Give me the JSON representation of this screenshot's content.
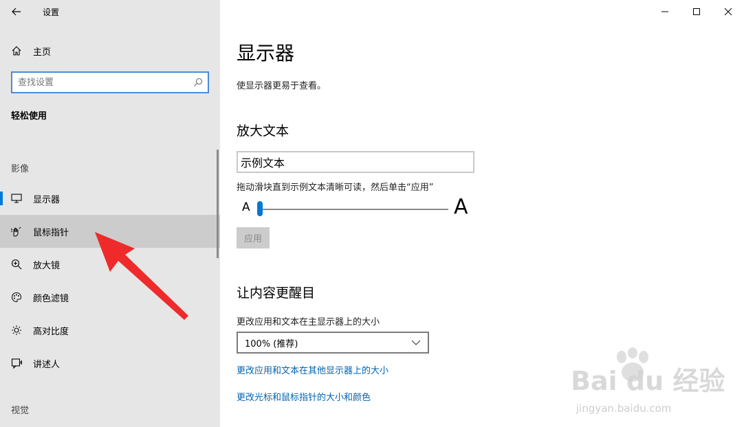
{
  "window": {
    "title": "设置",
    "controls": [
      "minimize-icon",
      "maximize-icon",
      "close-icon"
    ]
  },
  "sidebar": {
    "home_label": "主页",
    "search_placeholder": "查找设置",
    "category": "轻松使用",
    "groups": {
      "vision": "影像",
      "hearing": "视觉"
    },
    "items": [
      {
        "label": "显示器",
        "icon": "monitor-icon",
        "selected": true
      },
      {
        "label": "鼠标指针",
        "icon": "mouse-pointer-icon",
        "hover": true
      },
      {
        "label": "放大镜",
        "icon": "magnifier-icon"
      },
      {
        "label": "颜色滤镜",
        "icon": "palette-icon"
      },
      {
        "label": "高对比度",
        "icon": "sun-icon"
      },
      {
        "label": "讲述人",
        "icon": "narrator-icon"
      }
    ]
  },
  "main": {
    "title": "显示器",
    "description": "使显示器更易于查看。",
    "enlarge_text": {
      "heading": "放大文本",
      "sample_text": "示例文本",
      "hint": "拖动滑块直到示例文本清晰可读，然后单击“应用”",
      "small_a": "A",
      "big_a": "A",
      "slider_value_percent": 0,
      "apply_label": "应用"
    },
    "make_bigger": {
      "heading": "让内容更醒目",
      "size_label": "更改应用和文本在主显示器上的大小",
      "size_value": "100% (推荐)",
      "link_other_displays": "更改应用和文本在其他显示器上的大小",
      "link_cursor": "更改光标和鼠标指针的大小和颜色"
    }
  },
  "watermark": {
    "brand": "Bai du 经验",
    "url": "jingyan.baidu.com"
  },
  "colors": {
    "accent": "#0078d7",
    "link": "#0063b1",
    "sidebar_bg": "#e6e6e6",
    "annotation_arrow": "#ee2a2a"
  }
}
